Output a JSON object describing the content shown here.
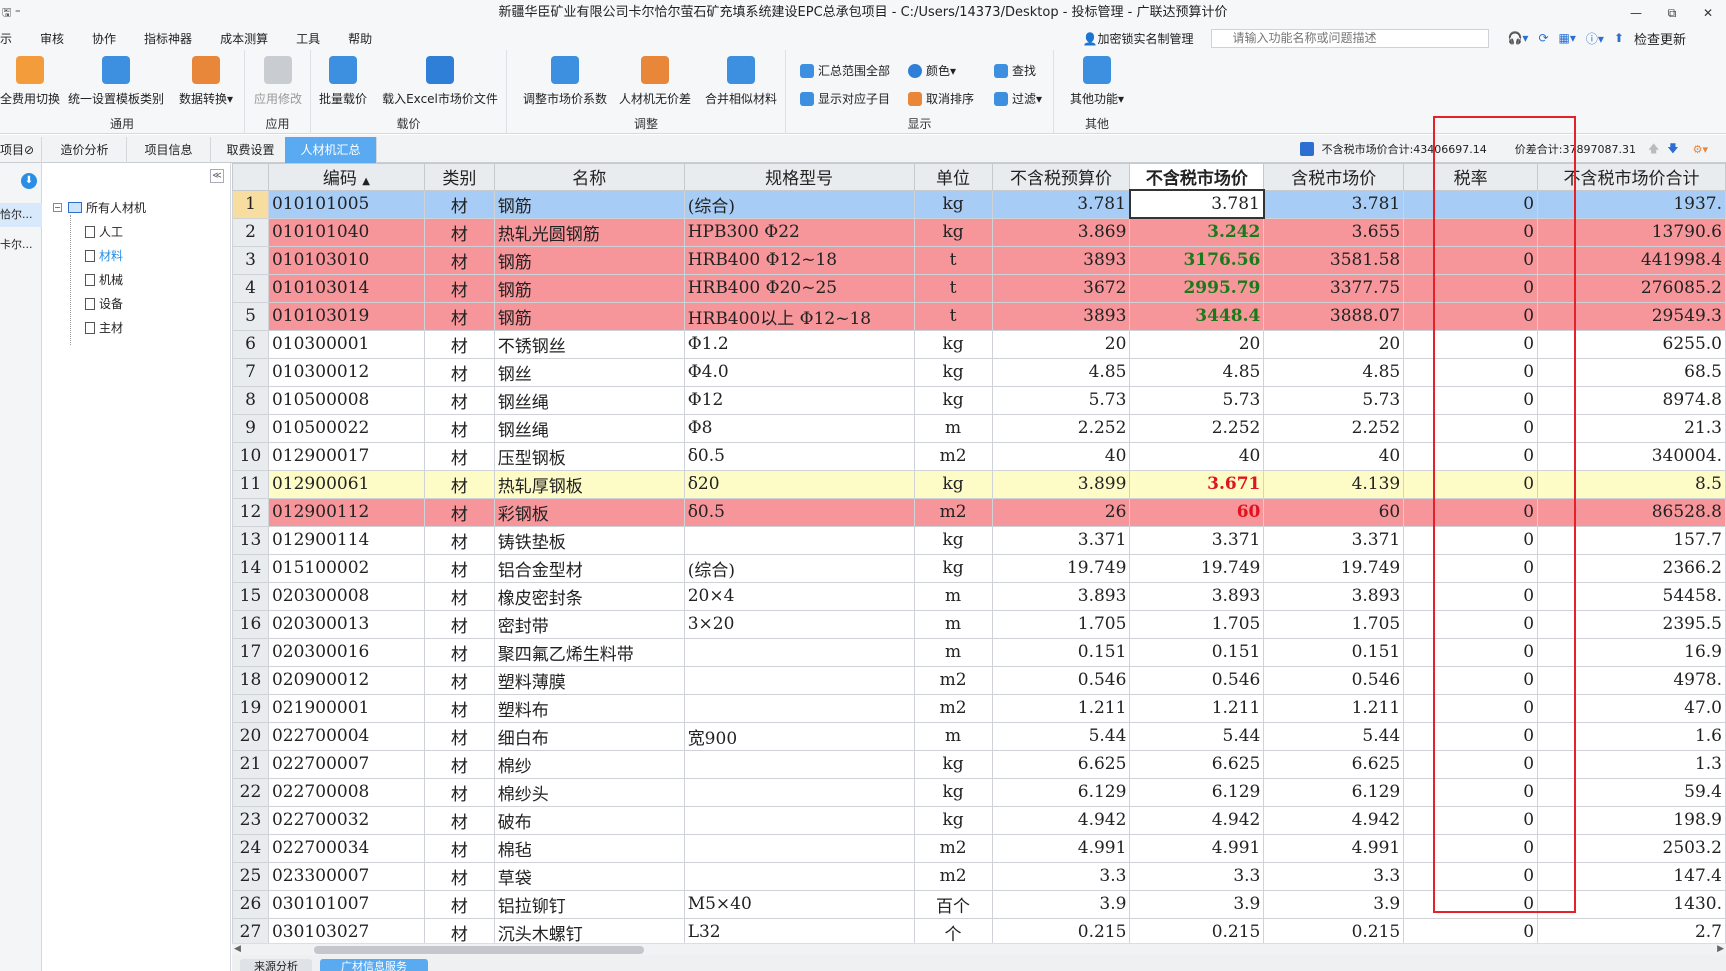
{
  "window": {
    "title": "新疆华臣矿业有限公司卡尔恰尔萤石矿充填系统建设EPC总承包项目 - C:/Users/14373/Desktop - 投标管理 - 广联达预算计价",
    "controls": [
      "—",
      "⧉",
      "✕"
    ]
  },
  "menu": {
    "items": [
      "示",
      "审核",
      "协作",
      "指标神器",
      "成本测算",
      "工具",
      "帮助"
    ],
    "lock_label": "加密锁实名制管理",
    "search_placeholder": "请输入功能名称或问题描述",
    "check_update": "检查更新"
  },
  "ribbon": {
    "groups": [
      {
        "label": "通用",
        "buttons": [
          "全费用切换",
          "统一设置模板类别",
          "数据转换▾"
        ]
      },
      {
        "label": "应用",
        "buttons": [
          "应用修改"
        ]
      },
      {
        "label": "载价",
        "buttons": [
          "批量载价",
          "载入Excel市场价文件"
        ]
      },
      {
        "label": "调整",
        "buttons": [
          "调整市场价系数",
          "人材机无价差",
          "合并相似材料"
        ]
      },
      {
        "label": "显示",
        "small": [
          "汇总范围全部",
          "显示对应子目",
          "颜色▾",
          "取消排序",
          "查找",
          "过滤▾"
        ]
      },
      {
        "label": "其他",
        "buttons": [
          "其他功能▾"
        ]
      }
    ]
  },
  "tabs": {
    "left_label": "项目",
    "items": [
      "造价分析",
      "项目信息",
      "取费设置",
      "人材机汇总"
    ],
    "active": "人材机汇总",
    "market_total": "不含税市场价合计:43406697.14",
    "diff_total": "价差合计:37897087.31"
  },
  "leftstrip": {
    "items": [
      "恰尔...",
      "卡尔..."
    ]
  },
  "tree": {
    "root": "所有人材机",
    "children": [
      "人工",
      "材料",
      "机械",
      "设备",
      "主材"
    ],
    "selected": "材料"
  },
  "grid": {
    "columns": [
      "编码",
      "类别",
      "名称",
      "规格型号",
      "单位",
      "不含税预算价",
      "不含税市场价",
      "含税市场价",
      "税率",
      "不含税市场价合计"
    ],
    "rows": [
      {
        "n": "1",
        "code": "010101005",
        "cat": "材",
        "name": "钢筋",
        "spec": "(综合)",
        "unit": "kg",
        "budget": "3.781",
        "market": "3.781",
        "taxm": "3.781",
        "rate": "0",
        "total": "1937.",
        "style": "sel",
        "mk": ""
      },
      {
        "n": "2",
        "code": "010101040",
        "cat": "材",
        "name": "热轧光圆钢筋",
        "spec": "HPB300  Φ22",
        "unit": "kg",
        "budget": "3.869",
        "market": "3.242",
        "taxm": "3.655",
        "rate": "0",
        "total": "13790.6",
        "style": "pink",
        "mk": "g"
      },
      {
        "n": "3",
        "code": "010103010",
        "cat": "材",
        "name": "钢筋",
        "spec": "HRB400  Φ12~18",
        "unit": "t",
        "budget": "3893",
        "market": "3176.56",
        "taxm": "3581.58",
        "rate": "0",
        "total": "441998.4",
        "style": "pink",
        "mk": "g"
      },
      {
        "n": "4",
        "code": "010103014",
        "cat": "材",
        "name": "钢筋",
        "spec": "HRB400  Φ20~25",
        "unit": "t",
        "budget": "3672",
        "market": "2995.79",
        "taxm": "3377.75",
        "rate": "0",
        "total": "276085.2",
        "style": "pink",
        "mk": "g"
      },
      {
        "n": "5",
        "code": "010103019",
        "cat": "材",
        "name": "钢筋",
        "spec": "HRB400以上  Φ12~18",
        "unit": "t",
        "budget": "3893",
        "market": "3448.4",
        "taxm": "3888.07",
        "rate": "0",
        "total": "29549.3",
        "style": "pink",
        "mk": "g"
      },
      {
        "n": "6",
        "code": "010300001",
        "cat": "材",
        "name": "不锈钢丝",
        "spec": "Φ1.2",
        "unit": "kg",
        "budget": "20",
        "market": "20",
        "taxm": "20",
        "rate": "0",
        "total": "6255.0",
        "style": "",
        "mk": ""
      },
      {
        "n": "7",
        "code": "010300012",
        "cat": "材",
        "name": "钢丝",
        "spec": "Φ4.0",
        "unit": "kg",
        "budget": "4.85",
        "market": "4.85",
        "taxm": "4.85",
        "rate": "0",
        "total": "68.5",
        "style": "",
        "mk": ""
      },
      {
        "n": "8",
        "code": "010500008",
        "cat": "材",
        "name": "钢丝绳",
        "spec": "Φ12",
        "unit": "kg",
        "budget": "5.73",
        "market": "5.73",
        "taxm": "5.73",
        "rate": "0",
        "total": "8974.8",
        "style": "",
        "mk": ""
      },
      {
        "n": "9",
        "code": "010500022",
        "cat": "材",
        "name": "钢丝绳",
        "spec": "Φ8",
        "unit": "m",
        "budget": "2.252",
        "market": "2.252",
        "taxm": "2.252",
        "rate": "0",
        "total": "21.3",
        "style": "",
        "mk": ""
      },
      {
        "n": "10",
        "code": "012900017",
        "cat": "材",
        "name": "压型钢板",
        "spec": "δ0.5",
        "unit": "m2",
        "budget": "40",
        "market": "40",
        "taxm": "40",
        "rate": "0",
        "total": "340004.",
        "style": "",
        "mk": ""
      },
      {
        "n": "11",
        "code": "012900061",
        "cat": "材",
        "name": "热轧厚钢板",
        "spec": "δ20",
        "unit": "kg",
        "budget": "3.899",
        "market": "3.671",
        "taxm": "4.139",
        "rate": "0",
        "total": "8.5",
        "style": "yel",
        "mk": "rd"
      },
      {
        "n": "12",
        "code": "012900112",
        "cat": "材",
        "name": "彩钢板",
        "spec": "δ0.5",
        "unit": "m2",
        "budget": "26",
        "market": "60",
        "taxm": "60",
        "rate": "0",
        "total": "86528.8",
        "style": "pink",
        "mk": "rd"
      },
      {
        "n": "13",
        "code": "012900114",
        "cat": "材",
        "name": "铸铁垫板",
        "spec": "",
        "unit": "kg",
        "budget": "3.371",
        "market": "3.371",
        "taxm": "3.371",
        "rate": "0",
        "total": "157.7",
        "style": "",
        "mk": ""
      },
      {
        "n": "14",
        "code": "015100002",
        "cat": "材",
        "name": "铝合金型材",
        "spec": "(综合)",
        "unit": "kg",
        "budget": "19.749",
        "market": "19.749",
        "taxm": "19.749",
        "rate": "0",
        "total": "2366.2",
        "style": "",
        "mk": ""
      },
      {
        "n": "15",
        "code": "020300008",
        "cat": "材",
        "name": "橡皮密封条",
        "spec": "20×4",
        "unit": "m",
        "budget": "3.893",
        "market": "3.893",
        "taxm": "3.893",
        "rate": "0",
        "total": "54458.",
        "style": "",
        "mk": ""
      },
      {
        "n": "16",
        "code": "020300013",
        "cat": "材",
        "name": "密封带",
        "spec": "3×20",
        "unit": "m",
        "budget": "1.705",
        "market": "1.705",
        "taxm": "1.705",
        "rate": "0",
        "total": "2395.5",
        "style": "",
        "mk": ""
      },
      {
        "n": "17",
        "code": "020300016",
        "cat": "材",
        "name": "聚四氟乙烯生料带",
        "spec": "",
        "unit": "m",
        "budget": "0.151",
        "market": "0.151",
        "taxm": "0.151",
        "rate": "0",
        "total": "16.9",
        "style": "",
        "mk": ""
      },
      {
        "n": "18",
        "code": "020900012",
        "cat": "材",
        "name": "塑料薄膜",
        "spec": "",
        "unit": "m2",
        "budget": "0.546",
        "market": "0.546",
        "taxm": "0.546",
        "rate": "0",
        "total": "4978.",
        "style": "",
        "mk": ""
      },
      {
        "n": "19",
        "code": "021900001",
        "cat": "材",
        "name": "塑料布",
        "spec": "",
        "unit": "m2",
        "budget": "1.211",
        "market": "1.211",
        "taxm": "1.211",
        "rate": "0",
        "total": "47.0",
        "style": "",
        "mk": ""
      },
      {
        "n": "20",
        "code": "022700004",
        "cat": "材",
        "name": "细白布",
        "spec": "宽900",
        "unit": "m",
        "budget": "5.44",
        "market": "5.44",
        "taxm": "5.44",
        "rate": "0",
        "total": "1.6",
        "style": "",
        "mk": ""
      },
      {
        "n": "21",
        "code": "022700007",
        "cat": "材",
        "name": "棉纱",
        "spec": "",
        "unit": "kg",
        "budget": "6.625",
        "market": "6.625",
        "taxm": "6.625",
        "rate": "0",
        "total": "1.3",
        "style": "",
        "mk": ""
      },
      {
        "n": "22",
        "code": "022700008",
        "cat": "材",
        "name": "棉纱头",
        "spec": "",
        "unit": "kg",
        "budget": "6.129",
        "market": "6.129",
        "taxm": "6.129",
        "rate": "0",
        "total": "59.4",
        "style": "",
        "mk": ""
      },
      {
        "n": "23",
        "code": "022700032",
        "cat": "材",
        "name": "破布",
        "spec": "",
        "unit": "kg",
        "budget": "4.942",
        "market": "4.942",
        "taxm": "4.942",
        "rate": "0",
        "total": "198.9",
        "style": "",
        "mk": ""
      },
      {
        "n": "24",
        "code": "022700034",
        "cat": "材",
        "name": "棉毡",
        "spec": "",
        "unit": "m2",
        "budget": "4.991",
        "market": "4.991",
        "taxm": "4.991",
        "rate": "0",
        "total": "2503.2",
        "style": "",
        "mk": ""
      },
      {
        "n": "25",
        "code": "023300007",
        "cat": "材",
        "name": "草袋",
        "spec": "",
        "unit": "m2",
        "budget": "3.3",
        "market": "3.3",
        "taxm": "3.3",
        "rate": "0",
        "total": "147.4",
        "style": "",
        "mk": ""
      },
      {
        "n": "26",
        "code": "030101007",
        "cat": "材",
        "name": "铝拉铆钉",
        "spec": "M5×40",
        "unit": "百个",
        "budget": "3.9",
        "market": "3.9",
        "taxm": "3.9",
        "rate": "0",
        "total": "1430.",
        "style": "",
        "mk": ""
      },
      {
        "n": "27",
        "code": "030103027",
        "cat": "材",
        "name": "沉头木螺钉",
        "spec": "L32",
        "unit": "个",
        "budget": "0.215",
        "market": "0.215",
        "taxm": "0.215",
        "rate": "0",
        "total": "2.7",
        "style": "",
        "mk": ""
      }
    ]
  },
  "bottom_tabs": [
    "来源分析",
    "广材信息服务"
  ],
  "colors": {
    "accent": "#5aaaf2",
    "pink_row": "#f6959a",
    "yellow_row": "#fdfbc6",
    "selected_row": "#a7cdf6",
    "highlight_box": "#e4222b"
  }
}
